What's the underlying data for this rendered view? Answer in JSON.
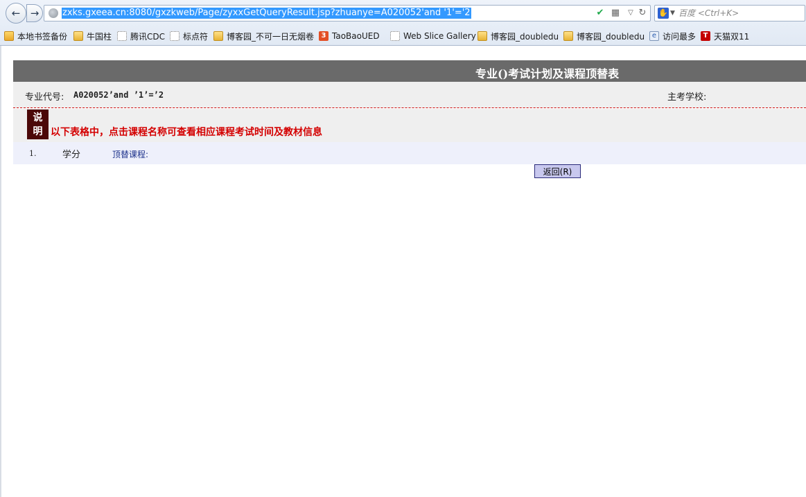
{
  "browser": {
    "url": "zxks.gxeea.cn:8080/gxzkweb/Page/zyxxGetQueryResult.jsp?zhuanye=A020052'and '1'='2",
    "search_placeholder": "百度 <Ctrl+K>",
    "search_engine_icon": "baidu-paw-icon",
    "nav_back_icon": "←",
    "nav_forward_icon": "→",
    "reload_icon": "↻",
    "dropdown_icon": "▽",
    "shield_icon": "✔",
    "qr_icon": "▦"
  },
  "bookmarks": [
    {
      "label": "本地书签备份",
      "icon": "folder"
    },
    {
      "label": "牛国柱",
      "icon": "rss"
    },
    {
      "label": "腾讯CDC",
      "icon": "dotted"
    },
    {
      "label": "标点符",
      "icon": "dotted"
    },
    {
      "label": "博客园_不可一日无烟卷",
      "icon": "rss"
    },
    {
      "label": "TaoBaoUED",
      "icon": "html5"
    },
    {
      "label": "Web Slice Gallery",
      "icon": "dotted"
    },
    {
      "label": "博客园_doubledu",
      "icon": "rss"
    },
    {
      "label": "博客园_doubledu",
      "icon": "rss"
    },
    {
      "label": "访问最多",
      "icon": "ie"
    },
    {
      "label": "天猫双11",
      "icon": "tmall"
    }
  ],
  "page": {
    "title": "专业()考试计划及课程顶替表",
    "major_code_label": "专业代号:",
    "major_code_value": "A020052’and ’1’=’2",
    "school_label": "主考学校:",
    "note_badge": "说明",
    "note_text": "以下表格中，点击课程名称可查看相应课程考试时间及教材信息",
    "course_row": {
      "number": "1.",
      "credit_label": "学分",
      "replace_label": "顶替课程:"
    },
    "back_button": "返回(R)"
  },
  "colors": {
    "title_bar": "#6a6a6a",
    "note_text": "#d40000",
    "note_badge": "#4b0808",
    "url_selection": "#3399ff",
    "back_button_bg": "#c8c8ee"
  }
}
